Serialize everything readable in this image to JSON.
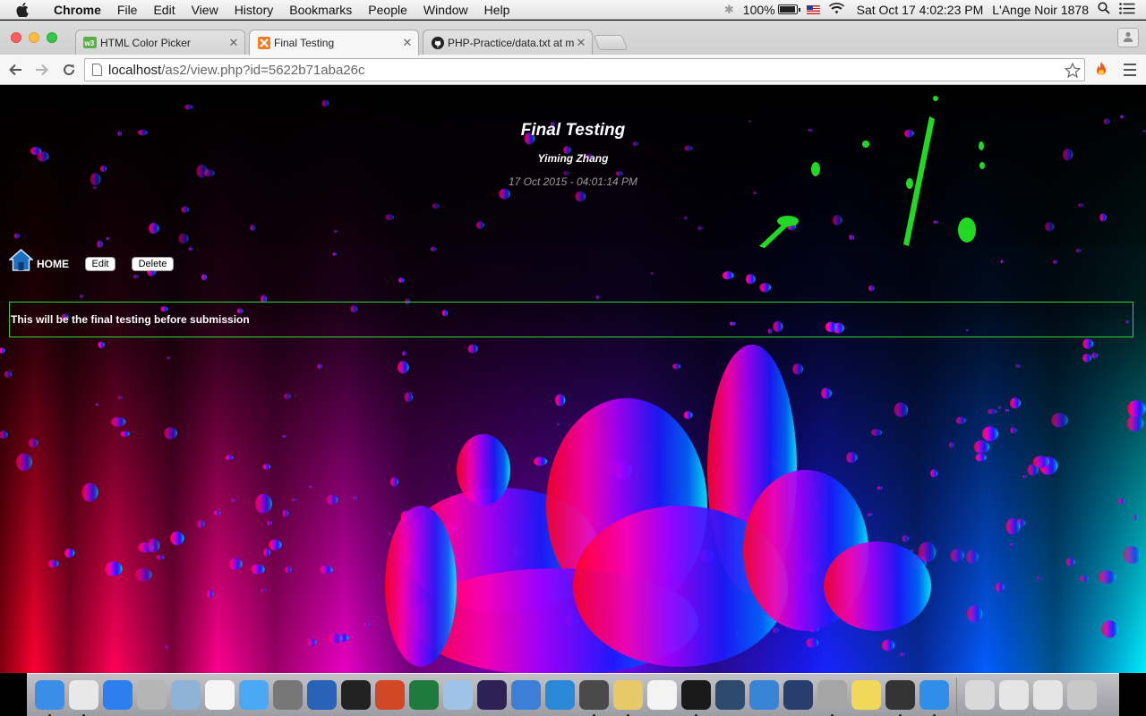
{
  "menubar": {
    "app_name": "Chrome",
    "items": [
      "File",
      "Edit",
      "View",
      "History",
      "Bookmarks",
      "People",
      "Window",
      "Help"
    ],
    "battery": "100%",
    "clock": "Sat Oct 17  4:02:23 PM",
    "user": "L'Ange Noir 1878"
  },
  "tabs": [
    {
      "title": "HTML Color Picker",
      "icon": "w3schools-icon",
      "active": false
    },
    {
      "title": "Final Testing",
      "icon": "xampp-icon",
      "active": true
    },
    {
      "title": "PHP-Practice/data.txt at m",
      "icon": "github-icon",
      "active": false
    }
  ],
  "toolbar": {
    "url_host": "localhost",
    "url_path": "/as2/view.php?id=5622b71aba26c"
  },
  "page": {
    "title": "Final Testing",
    "author": "Yiming Zhang",
    "date": "17 Oct 2015 - 04:01:14 PM",
    "home_label": "HOME",
    "edit_label": "Edit",
    "delete_label": "Delete",
    "content": "This will be the final testing before submission",
    "border_color": "#35d435"
  },
  "dock": {
    "apps": [
      {
        "name": "finder",
        "color": "#3a8ee6"
      },
      {
        "name": "chrome",
        "color": "#e8e8e8"
      },
      {
        "name": "safari",
        "color": "#2d7ff0"
      },
      {
        "name": "calculator",
        "color": "#b5b5b5"
      },
      {
        "name": "preview",
        "color": "#8fb3d6"
      },
      {
        "name": "calendar",
        "color": "#f5f5f5"
      },
      {
        "name": "messages",
        "color": "#4aa8f5"
      },
      {
        "name": "system-preferences",
        "color": "#777777"
      },
      {
        "name": "word",
        "color": "#2a62b8"
      },
      {
        "name": "qq",
        "color": "#222222"
      },
      {
        "name": "powerpoint",
        "color": "#d24726"
      },
      {
        "name": "excel",
        "color": "#1f7a3e"
      },
      {
        "name": "virtualbox",
        "color": "#9ec3e6"
      },
      {
        "name": "eclipse",
        "color": "#2c2255"
      },
      {
        "name": "intellij",
        "color": "#3d7fd6"
      },
      {
        "name": "wunderlist",
        "color": "#2b88d9"
      },
      {
        "name": "sublime-text",
        "color": "#4a4a4a"
      },
      {
        "name": "notes",
        "color": "#e8c96a"
      },
      {
        "name": "photos",
        "color": "#f3f3f3"
      },
      {
        "name": "terminal",
        "color": "#1a1a1a"
      },
      {
        "name": "mysql-workbench",
        "color": "#2c4a6e"
      },
      {
        "name": "xcode",
        "color": "#3a84d8"
      },
      {
        "name": "quicktime",
        "color": "#2a3e6e"
      },
      {
        "name": "settings",
        "color": "#a5a5a5"
      },
      {
        "name": "stickies",
        "color": "#f0d957"
      },
      {
        "name": "printer",
        "color": "#333333"
      },
      {
        "name": "icloud",
        "color": "#2f8ee8"
      },
      {
        "name": "archive",
        "color": "#d9d9d9"
      },
      {
        "name": "screenshot-window",
        "color": "#e5e5e5"
      },
      {
        "name": "screenshot-window-2",
        "color": "#e5e5e5"
      },
      {
        "name": "trash",
        "color": "#c8c8c8"
      }
    ]
  }
}
